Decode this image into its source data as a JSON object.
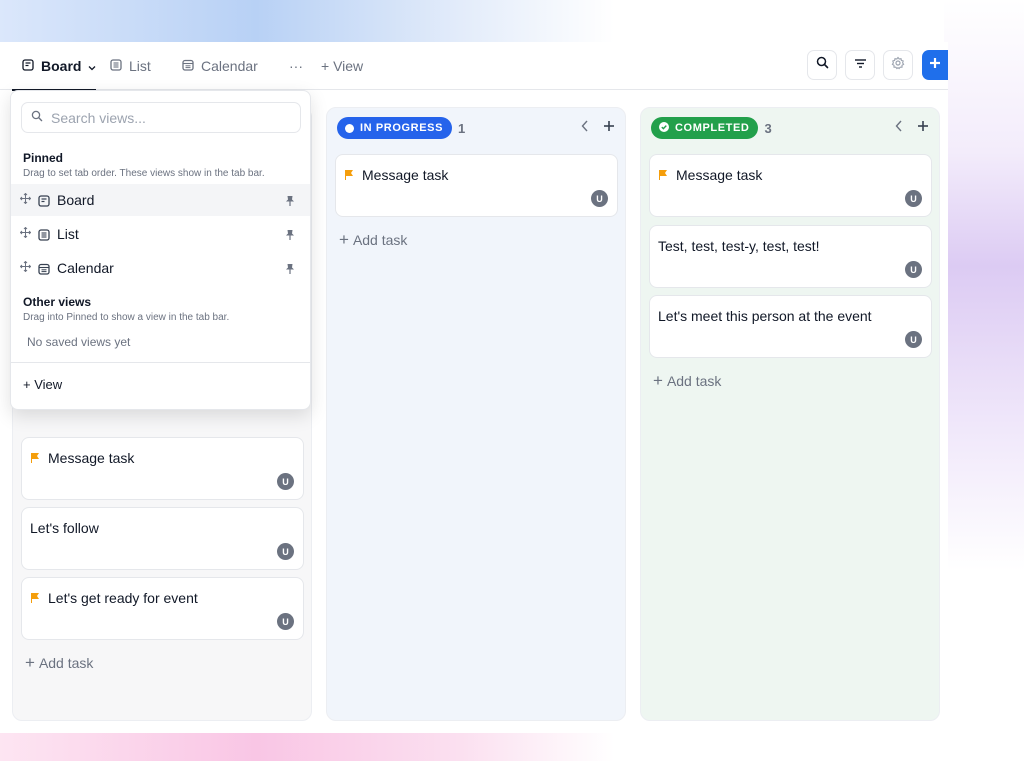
{
  "toolbar": {
    "tabs": [
      {
        "label": "Board",
        "icon": "board-icon",
        "active": true
      },
      {
        "label": "List",
        "icon": "list-icon",
        "active": false
      },
      {
        "label": "Calendar",
        "icon": "calendar-icon",
        "active": false
      }
    ],
    "more_label": "···",
    "add_view_label": "+ View",
    "actions": [
      "search-icon",
      "filter-icon",
      "settings-icon",
      "plus-icon"
    ]
  },
  "dropdown": {
    "search_placeholder": "Search views...",
    "pinned_title": "Pinned",
    "pinned_hint": "Drag to set tab order. These views show in the tab bar.",
    "pinned_items": [
      {
        "label": "Board",
        "icon": "board-icon"
      },
      {
        "label": "List",
        "icon": "list-icon"
      },
      {
        "label": "Calendar",
        "icon": "calendar-icon"
      }
    ],
    "other_title": "Other views",
    "other_hint": "Drag into Pinned to show a view in the tab bar.",
    "empty_text": "No saved views yet",
    "add_label": "+ View"
  },
  "columns": {
    "todo": {
      "cards": [
        {
          "title": "Message task",
          "flag": true,
          "assignee": "U"
        },
        {
          "title": "Let's follow",
          "flag": false,
          "assignee": "U"
        },
        {
          "title": "Let's get ready for event",
          "flag": true,
          "assignee": "U"
        }
      ],
      "add_task_label": "Add task"
    },
    "in_progress": {
      "status": "IN PROGRESS",
      "count": "1",
      "color": "#2563eb",
      "cards": [
        {
          "title": "Message task",
          "flag": true,
          "assignee": "U"
        }
      ],
      "add_task_label": "Add task"
    },
    "completed": {
      "status": "COMPLETED",
      "count": "3",
      "color": "#22a04b",
      "cards": [
        {
          "title": "Message task",
          "flag": true,
          "assignee": "U"
        },
        {
          "title": "Test, test, test-y, test, test!",
          "flag": false,
          "assignee": "U"
        },
        {
          "title": "Let's meet this person at the event",
          "flag": false,
          "assignee": "U"
        }
      ],
      "add_task_label": "Add task"
    }
  },
  "colors": {
    "accent": "#1f6feb",
    "flag": "#f59e0b",
    "avatar": "#6b7280"
  }
}
